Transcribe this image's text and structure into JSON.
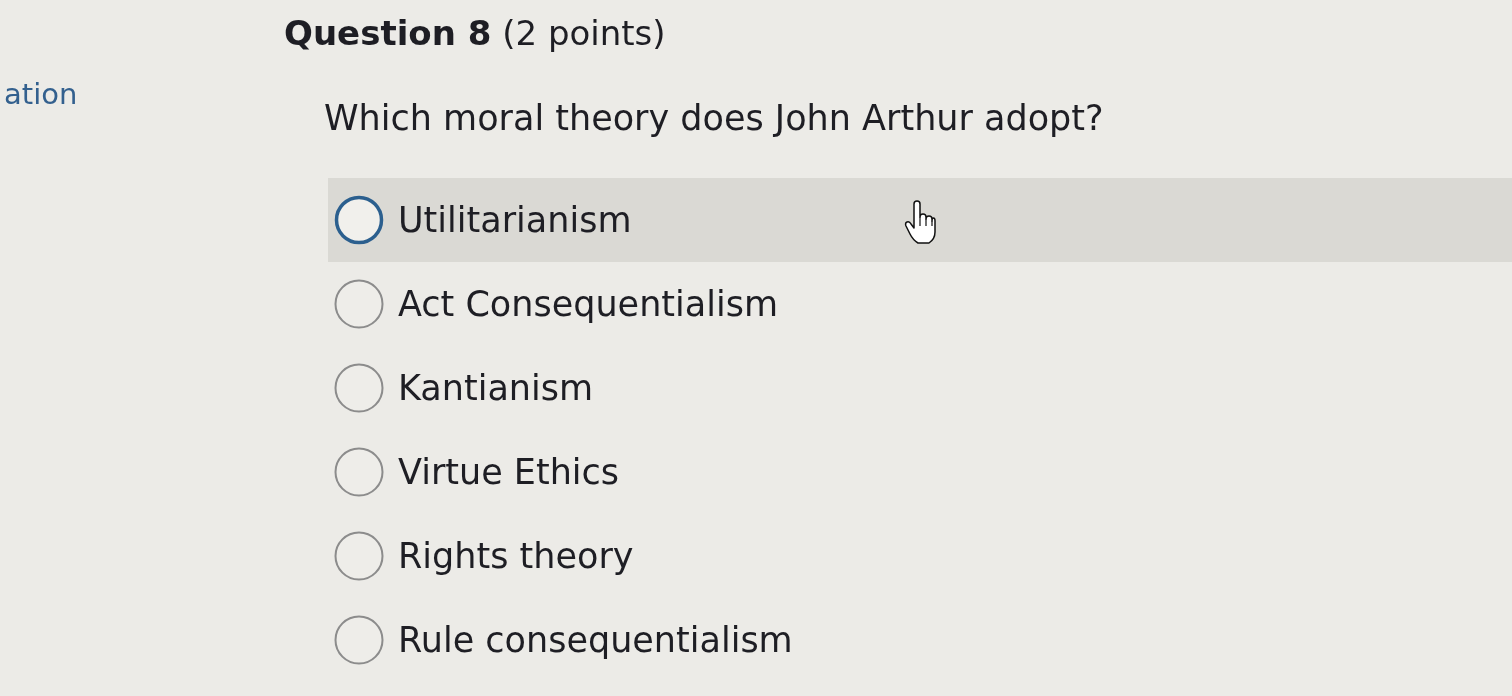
{
  "sidebar": {
    "link": "ation"
  },
  "question": {
    "title": "**Question 8** (2 points)",
    "prompt": "Which moral theory does John Arthur adopt?"
  },
  "options": [
    {
      "label": "Utilitarianism",
      "selected": false,
      "hovered": true
    },
    {
      "label": "Act Consequentialism",
      "selected": false,
      "hovered": false
    },
    {
      "label": "Kantianism",
      "selected": false,
      "hovered": false
    },
    {
      "label": "Virtue Ethics",
      "selected": false,
      "hovered": false
    },
    {
      "label": "Rights theory",
      "selected": false,
      "hovered": false
    },
    {
      "label": "Rule consequentialism",
      "selected": false,
      "hovered": false
    }
  ]
}
